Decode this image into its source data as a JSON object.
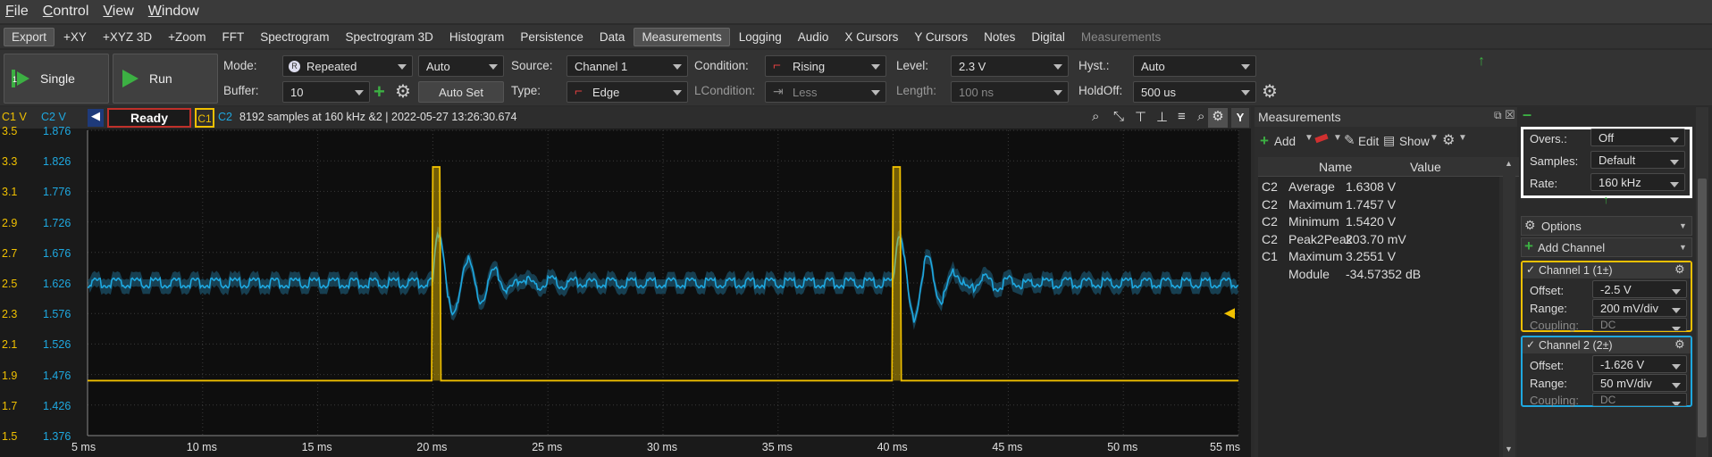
{
  "menu": [
    "File",
    "Control",
    "View",
    "Window"
  ],
  "tabs": [
    "Export",
    "+XY",
    "+XYZ 3D",
    "+Zoom",
    "FFT",
    "Spectrogram",
    "Spectrogram 3D",
    "Histogram",
    "Persistence",
    "Data",
    "Measurements",
    "Logging",
    "Audio",
    "X Cursors",
    "Y Cursors",
    "Notes",
    "Digital",
    "Measurements"
  ],
  "toolbar": {
    "single": "Single",
    "run": "Run",
    "mode_label": "Mode:",
    "mode": "Repeated",
    "auto": "Auto",
    "buffer_label": "Buffer:",
    "buffer": "10",
    "autoset": "Auto Set",
    "source_label": "Source:",
    "source": "Channel 1",
    "type_label": "Type:",
    "type": "Edge",
    "condition_label": "Condition:",
    "condition": "Rising",
    "lcondition_label": "LCondition:",
    "lcondition": "Less",
    "level_label": "Level:",
    "level": "2.3 V",
    "length_label": "Length:",
    "length": "100 ns",
    "hyst_label": "Hyst.:",
    "hyst": "Auto",
    "holdoff_label": "HoldOff:",
    "holdoff": "500 us"
  },
  "plot": {
    "c1_axis": "C1 V",
    "c2_axis": "C2 V",
    "status": "Ready",
    "c1": "C1",
    "c2": "C2",
    "info": "8192 samples at 160 kHz &2 | 2022-05-27 13:26:30.674",
    "c1_ticks": [
      "3.5",
      "3.3",
      "3.1",
      "2.9",
      "2.7",
      "2.5",
      "2.3",
      "2.1",
      "1.9",
      "1.7",
      "1.5"
    ],
    "c2_ticks": [
      "1.876",
      "1.826",
      "1.776",
      "1.726",
      "1.676",
      "1.626",
      "1.576",
      "1.526",
      "1.476",
      "1.426",
      "1.376"
    ],
    "x_ticks": [
      "5 ms",
      "10 ms",
      "15 ms",
      "20 ms",
      "25 ms",
      "30 ms",
      "35 ms",
      "40 ms",
      "45 ms",
      "50 ms",
      "55 ms"
    ],
    "colors": {
      "c1": "#f0c000",
      "c2": "#1ea8e0"
    }
  },
  "measurements": {
    "title": "Measurements",
    "add": "Add",
    "edit": "Edit",
    "show": "Show",
    "col_name": "Name",
    "col_value": "Value",
    "rows": [
      {
        "ch": "C2",
        "name": "Average",
        "value": "1.6308 V"
      },
      {
        "ch": "C2",
        "name": "Maximum",
        "value": "1.7457 V"
      },
      {
        "ch": "C2",
        "name": "Minimum",
        "value": "1.5420 V"
      },
      {
        "ch": "C2",
        "name": "Peak2Peak",
        "value": "203.70 mV"
      },
      {
        "ch": "C1",
        "name": "Maximum",
        "value": "3.2551 V"
      },
      {
        "ch": "",
        "name": "Module",
        "value": "-34.57352 dB"
      }
    ]
  },
  "side": {
    "overs_label": "Overs.:",
    "overs": "Off",
    "samples_label": "Samples:",
    "samples": "Default",
    "rate_label": "Rate:",
    "rate": "160 kHz",
    "options": "Options",
    "add_channel": "Add Channel",
    "ch1": {
      "title": "Channel 1 (1±)",
      "offset_label": "Offset:",
      "offset": "-2.5 V",
      "range_label": "Range:",
      "range": "200 mV/div",
      "coupling_label": "Coupling:",
      "coupling": "DC"
    },
    "ch2": {
      "title": "Channel 2 (2±)",
      "offset_label": "Offset:",
      "offset": "-1.626 V",
      "range_label": "Range:",
      "range": "50 mV/div",
      "coupling_label": "Coupling:",
      "coupling": "DC"
    }
  }
}
